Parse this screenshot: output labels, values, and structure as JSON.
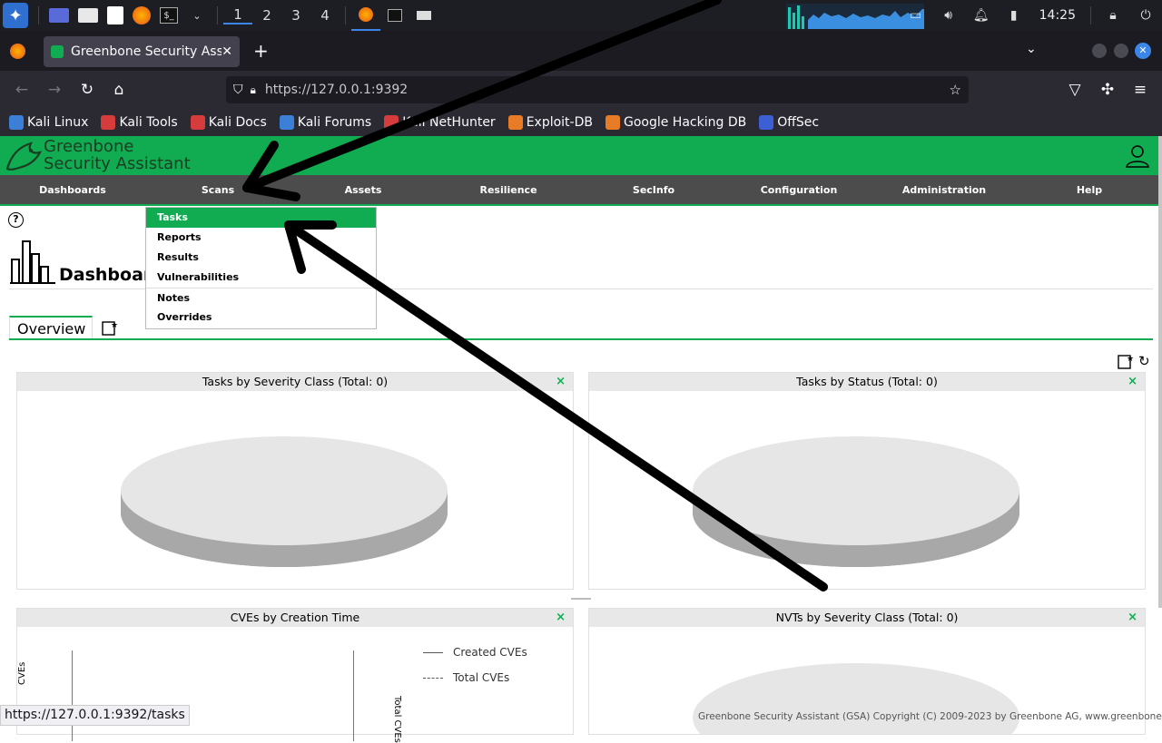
{
  "taskbar": {
    "workspaces": [
      "1",
      "2",
      "3",
      "4"
    ],
    "clock": "14:25"
  },
  "browser": {
    "tab_title": "Greenbone Security Assistant",
    "url": "https://127.0.0.1:9392",
    "bookmarks": [
      {
        "label": "Kali Linux",
        "color": "#3c7fd6"
      },
      {
        "label": "Kali Tools",
        "color": "#d63c3c"
      },
      {
        "label": "Kali Docs",
        "color": "#d63c3c"
      },
      {
        "label": "Kali Forums",
        "color": "#3c7fd6"
      },
      {
        "label": "Kali NetHunter",
        "color": "#d63c3c"
      },
      {
        "label": "Exploit-DB",
        "color": "#e87b25"
      },
      {
        "label": "Google Hacking DB",
        "color": "#e87b25"
      },
      {
        "label": "OffSec",
        "color": "#3c5fd6"
      }
    ],
    "status_url": "https://127.0.0.1:9392/tasks"
  },
  "gsa": {
    "logo_line1": "Greenbone",
    "logo_line2": "Security Assistant",
    "menu": [
      "Dashboards",
      "Scans",
      "Assets",
      "Resilience",
      "SecInfo",
      "Configuration",
      "Administration",
      "Help"
    ],
    "scans_dropdown": [
      "Tasks",
      "Reports",
      "Results",
      "Vulnerabilities",
      "Notes",
      "Overrides"
    ],
    "page_title": "Dashboards",
    "tab_overview": "Overview",
    "panels": {
      "p1": {
        "title": "Tasks by Severity Class (Total: 0)"
      },
      "p2": {
        "title": "Tasks by Status (Total: 0)"
      },
      "p3": {
        "title": "CVEs by Creation Time",
        "legend1": "Created CVEs",
        "legend2": "Total CVEs",
        "ylabel_left": "CVEs",
        "ylabel_right": "Total CVEs"
      },
      "p4": {
        "title": "NVTs by Severity Class (Total: 0)"
      }
    },
    "close_glyph": "×",
    "footer": "Greenbone Security Assistant (GSA) Copyright (C) 2009-2023 by Greenbone AG, www.greenbone.net"
  },
  "colors": {
    "gsa_green": "#11ab51",
    "menu_bg": "#4c4c4c"
  }
}
